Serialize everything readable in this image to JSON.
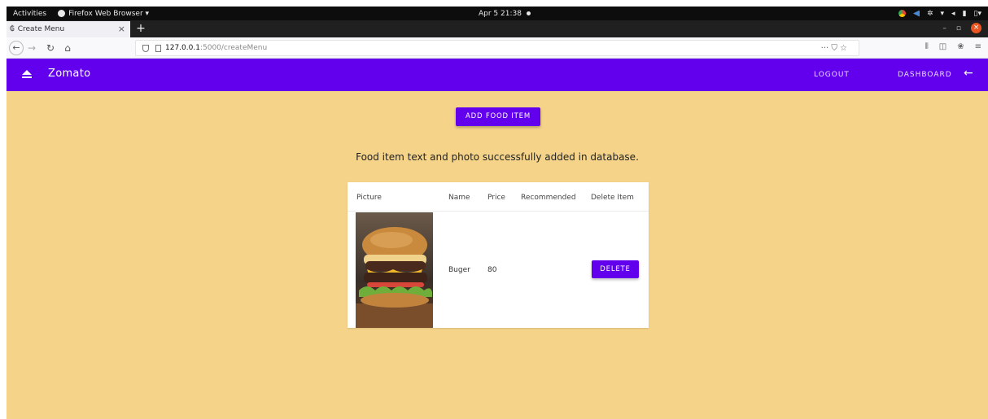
{
  "system_bar": {
    "activities": "Activities",
    "app_name": "Firefox Web Browser ▾",
    "clock": "Apr 5  21:38"
  },
  "browser": {
    "tab_title": "Create Menu",
    "tab_close": "×",
    "new_tab": "+",
    "url_host": "127.0.0.1",
    "url_path": ":5000/createMenu",
    "url_actions": "··· ⛉ ☆"
  },
  "app": {
    "brand": "Zomato",
    "logout_label": "LOGOUT",
    "dashboard_label": "DASHBOARD",
    "accent_color": "#6200ee",
    "background_color": "#f5d48a"
  },
  "main": {
    "add_button_label": "ADD FOOD ITEM",
    "status_message": "Food item text and photo successfully added in database.",
    "table": {
      "headers": {
        "picture": "Picture",
        "name": "Name",
        "price": "Price",
        "recommended": "Recommended",
        "delete": "Delete Item"
      },
      "rows": [
        {
          "picture": "burger",
          "name": "Buger",
          "price": "80",
          "recommended": "",
          "delete_label": "DELETE"
        }
      ]
    }
  }
}
